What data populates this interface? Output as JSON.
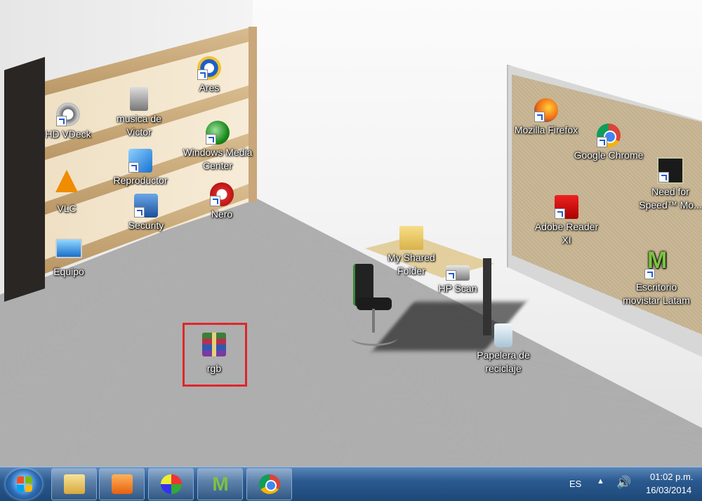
{
  "desktop": {
    "icons": [
      {
        "label": "HD VDeck",
        "icon": "hd-vdeck-icon"
      },
      {
        "label": "musica de Victor",
        "icon": "music-folder-icon"
      },
      {
        "label": "Ares",
        "icon": "ares-icon"
      },
      {
        "label": "Windows Media Center",
        "icon": "windows-media-center-icon"
      },
      {
        "label": "VLC",
        "icon": "vlc-icon"
      },
      {
        "label": "Reproductor",
        "icon": "media-player-icon"
      },
      {
        "label": "Nero",
        "icon": "nero-icon"
      },
      {
        "label": "Security",
        "icon": "security-icon"
      },
      {
        "label": "Equipo",
        "icon": "computer-icon"
      },
      {
        "label": "Mozilla Firefox",
        "icon": "firefox-icon"
      },
      {
        "label": "Google Chrome",
        "icon": "chrome-icon"
      },
      {
        "label": "Need for Speed™ Mo...",
        "icon": "need-for-speed-icon"
      },
      {
        "label": "Adobe Reader XI",
        "icon": "adobe-reader-icon"
      },
      {
        "label": "Escritorio movistar Latam",
        "icon": "movistar-icon"
      },
      {
        "label": "My Shared Folder",
        "icon": "shared-folder-icon"
      },
      {
        "label": "HP Scan",
        "icon": "hp-scan-icon"
      },
      {
        "label": "Papelera de reciclaje",
        "icon": "recycle-bin-icon"
      },
      {
        "label": "rgb",
        "icon": "winrar-archive-icon"
      }
    ],
    "selected_icon": "rgb",
    "highlight_color": "#e0252a"
  },
  "taskbar": {
    "start_label": "Start",
    "pinned": [
      {
        "name": "Windows Explorer",
        "icon": "explorer-icon"
      },
      {
        "name": "Windows Media Player",
        "icon": "media-player-icon"
      },
      {
        "name": "Paint",
        "icon": "paint-icon"
      },
      {
        "name": "Movistar",
        "icon": "movistar-icon"
      },
      {
        "name": "Google Chrome",
        "icon": "chrome-icon"
      }
    ],
    "tray": {
      "language": "ES",
      "show_hidden_icon": "chevron-up-icon",
      "volume_icon": "volume-icon",
      "time": "01:02 p.m.",
      "date": "16/03/2014"
    }
  }
}
